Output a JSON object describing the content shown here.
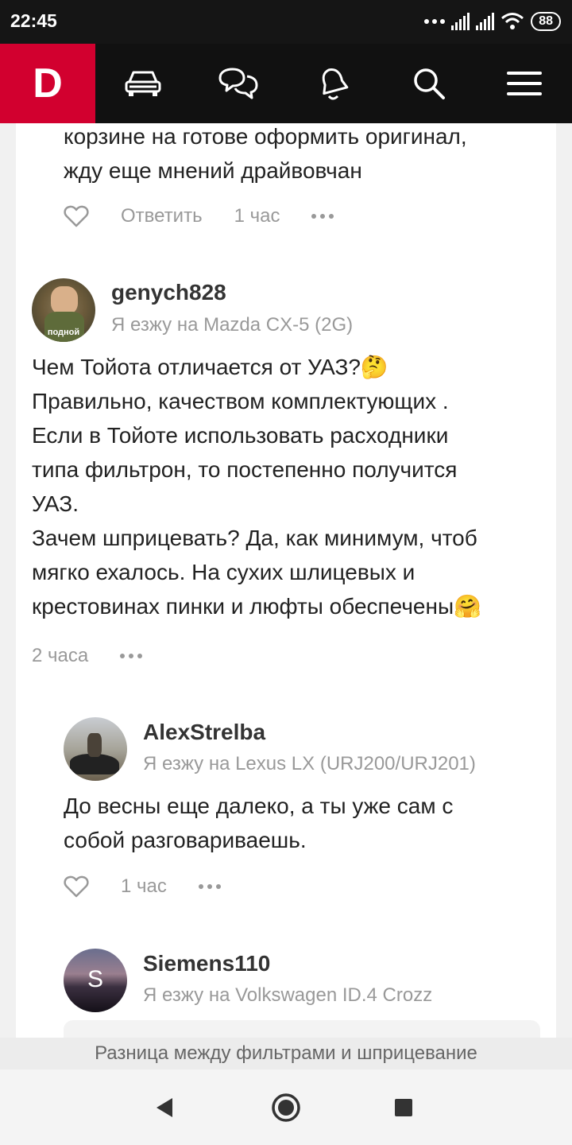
{
  "status": {
    "time": "22:45",
    "battery": "88"
  },
  "nav": {
    "logo": "D"
  },
  "comments": {
    "top": {
      "lines": [
        "корзине на готове оформить оригинал,",
        "жду еще мнений драйвовчан"
      ],
      "reply": "Ответить",
      "time": "1 час"
    },
    "c1": {
      "user": "genych828",
      "car": "Я езжу на Mazda CX-5 (2G)",
      "avatar_caption": "подной",
      "lines": [
        "Чем Тойота отличается от УАЗ?🤔",
        "Правильно, качеством комплектующих .",
        "Если в Тойоте использовать расходники",
        "типа фильтрон, то постепенно получится",
        "УАЗ.",
        "Зачем шприцевать? Да, как минимум, чтоб",
        "мягко ехалось. На сухих шлицевых и",
        "крестовинах пинки и люфты обеспечены🤗"
      ],
      "time": "2 часа"
    },
    "c2": {
      "user": "AlexStrelba",
      "car": "Я езжу на Lexus LX (URJ200/URJ201)",
      "lines": [
        "До весны еще далеко, а ты уже сам с",
        "собой разговариваешь."
      ],
      "time": "1 час"
    },
    "c3": {
      "user": "Siemens110",
      "car": "Я езжу на Volkswagen ID.4 Crozz",
      "avatar_letter": "S"
    }
  },
  "page_title": "Разница между фильтрами и шприцевание",
  "colors": {
    "brand": "#d2002f",
    "nav_bg": "#111111",
    "muted": "#999999"
  }
}
